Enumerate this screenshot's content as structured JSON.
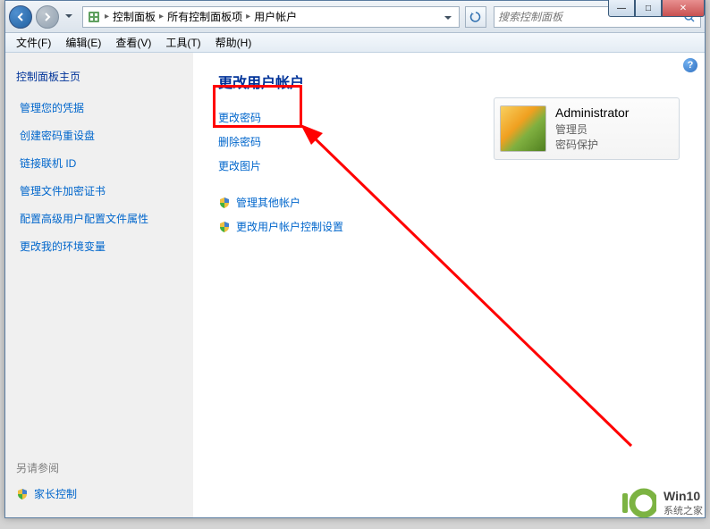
{
  "titlebar": {
    "min": "—",
    "max": "□",
    "close": "✕"
  },
  "breadcrumb": {
    "items": [
      "控制面板",
      "所有控制面板项",
      "用户帐户"
    ]
  },
  "search": {
    "placeholder": "搜索控制面板"
  },
  "menubar": {
    "items": [
      "文件(F)",
      "编辑(E)",
      "查看(V)",
      "工具(T)",
      "帮助(H)"
    ]
  },
  "sidebar": {
    "title": "控制面板主页",
    "links": [
      "管理您的凭据",
      "创建密码重设盘",
      "链接联机 ID",
      "管理文件加密证书",
      "配置高级用户配置文件属性",
      "更改我的环境变量"
    ],
    "see_also": "另请参阅",
    "footer_link": "家长控制"
  },
  "main": {
    "heading": "更改用户帐户",
    "actions": [
      "更改密码",
      "删除密码",
      "更改图片"
    ],
    "shield_actions": [
      "管理其他帐户",
      "更改用户帐户控制设置"
    ]
  },
  "user": {
    "name": "Administrator",
    "role": "管理员",
    "protection": "密码保护"
  },
  "help": "?",
  "watermark": {
    "title": "Win10",
    "subtitle": "系统之家"
  }
}
